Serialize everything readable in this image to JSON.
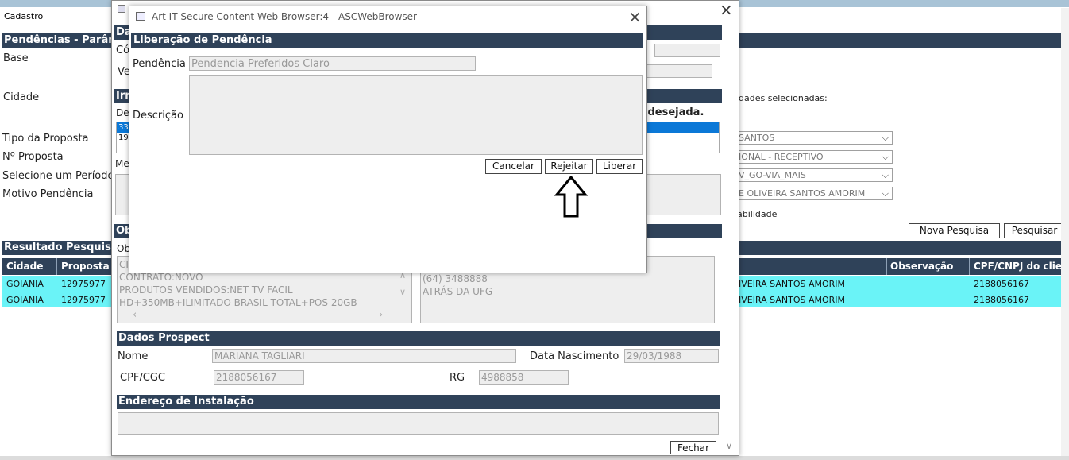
{
  "app": {
    "tab_label": "Cadastro"
  },
  "bg": {
    "section_title": "Pendências - Parâm",
    "labels": {
      "base": "Base",
      "cidade": "Cidade",
      "tipo_proposta": "Tipo da Proposta",
      "numero_proposta": "Nº Proposta",
      "periodo": "Selecione um Período",
      "motivo": "Motivo Pendência"
    },
    "right_note": "dades selecionadas:",
    "selects": [
      "SANTOS",
      "IONAL - RECEPTIVO",
      "V_GO-VIA_MAIS",
      "E OLIVEIRA SANTOS AMORIM"
    ],
    "checkbox_label": "abilidade",
    "nova_pesquisa": "Nova Pesquisa",
    "pesquisar": "Pesquisar",
    "resultado_title": "Resultado Pesquisa",
    "columns": {
      "cidade": "Cidade",
      "proposta": "Proposta",
      "observacao": "Observação",
      "cpf": "CPF/CNPJ do clien"
    },
    "rows": [
      {
        "cidade": "GOIANIA",
        "proposta": "12975977",
        "vendedor": "IVEIRA SANTOS AMORIM",
        "cpf": "2188056167"
      },
      {
        "cidade": "GOIANIA",
        "proposta": "12975977",
        "vendedor": "IVEIRA SANTOS AMORIM",
        "cpf": "2188056167"
      }
    ]
  },
  "detail": {
    "dados_frag": "Da",
    "co_frag": "Có",
    "ve_frag": "Ve",
    "irr_frag": "Irr",
    "de_frag": "De",
    "list_items": [
      "33",
      "19"
    ],
    "desejada_text": "cia desejada.",
    "me_frag": "Me",
    "ob_frag": "Ob",
    "ob2_frag": "Ob",
    "obs_left": [
      "CI",
      "CONTRATO:NOVO",
      "PRODUTOS VENDIDOS:NET TV FACIL",
      "HD+350MB+ILIMITADO BRASIL TOTAL+POS 20GB"
    ],
    "obs_right": [
      "(64) 3488888",
      "ATRÁS DA UFG"
    ],
    "prospect_title": "Dados Prospect",
    "nome_label": "Nome",
    "nome_value": "MARIANA TAGLIARI",
    "nasc_label": "Data Nascimento",
    "nasc_value": "29/03/1988",
    "cpf_label": "CPF/CGC",
    "cpf_value": "2188056167",
    "rg_label": "RG",
    "rg_value": "4988858",
    "endereco_title": "Endereço de Instalação",
    "fechar": "Fechar"
  },
  "dialog": {
    "title": "Art IT Secure Content Web Browser:4 - ASCWebBrowser",
    "section_title": "Liberação de Pendência",
    "pendencia_label": "Pendência",
    "pendencia_value": "Pendencia Preferidos Claro",
    "descricao_label": "Descrição",
    "descricao_value": "",
    "cancelar": "Cancelar",
    "rejeitar": "Rejeitar",
    "liberar": "Liberar"
  },
  "icons": {
    "close": "×",
    "arrow_up": "⇧",
    "chevron_down": "⌄"
  }
}
